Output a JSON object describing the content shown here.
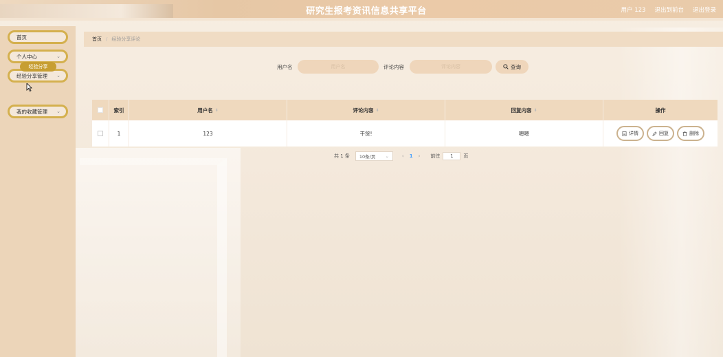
{
  "header": {
    "title": "研究生报考资讯信息共享平台",
    "user": "用户 123",
    "exit_admin": "退出到前台",
    "logout": "退出登录"
  },
  "sidebar": {
    "items": [
      {
        "label": "首页",
        "has_chevron": false
      },
      {
        "label": "个人中心",
        "has_chevron": true
      },
      {
        "label": "经验分享管理",
        "has_chevron": true,
        "sub_items": [
          "经验分享"
        ]
      },
      {
        "label": "我的收藏管理",
        "has_chevron": true
      }
    ]
  },
  "breadcrumb": {
    "home": "首页",
    "sep": "/",
    "current": "经验分享评论"
  },
  "search": {
    "username_label": "用户名",
    "username_placeholder": "用户名",
    "comment_label": "评论内容",
    "comment_placeholder": "评论内容",
    "query_label": "查询",
    "query_icon": "search-icon"
  },
  "table": {
    "columns": [
      "索引",
      "用户名",
      "评论内容",
      "回复内容",
      "操作"
    ],
    "rows": [
      {
        "index": "1",
        "username": "123",
        "comment": "干货!",
        "reply": "嗯嗯"
      }
    ],
    "ops": {
      "detail": "详情",
      "reply": "回复",
      "delete": "删除"
    }
  },
  "pagination": {
    "total": "共 1 条",
    "page_size": "10条/页",
    "current_page": "1",
    "goto_label": "前往",
    "goto_value": "1",
    "page_suffix": "页"
  },
  "colors": {
    "accent": "#d4b04e",
    "sub_active": "#c79e32",
    "header_bg": "#e6c7a5"
  }
}
